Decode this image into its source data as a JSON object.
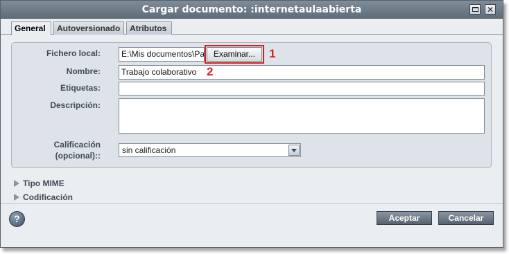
{
  "window": {
    "title": "Cargar documento: :internetaulaabierta",
    "maximize_icon": "maximize-icon",
    "close_icon": "close-icon",
    "close_glyph": "✕"
  },
  "tabs": [
    {
      "label": "General",
      "active": true
    },
    {
      "label": "Autoversionado",
      "active": false
    },
    {
      "label": "Atributos",
      "active": false
    }
  ],
  "form": {
    "local_file_label": "Fichero local:",
    "local_file_value": "E:\\Mis documentos\\Pa",
    "browse_label": "Examinar...",
    "name_label": "Nombre:",
    "name_value": "Trabajo colaborativo",
    "tags_label": "Etiquetas:",
    "tags_value": "",
    "description_label": "Descripción:",
    "description_value": "",
    "rating_label_line1": "Calificación",
    "rating_label_line2": "(opcional)::",
    "rating_value": "sin calificación"
  },
  "annotations": {
    "marker_1": "1",
    "marker_2": "2",
    "color": "#d61f1f"
  },
  "sections": {
    "mime_label": "Tipo MIME",
    "encoding_label": "Codificación"
  },
  "footer": {
    "help_glyph": "?",
    "accept_label": "Aceptar",
    "cancel_label": "Cancelar"
  }
}
